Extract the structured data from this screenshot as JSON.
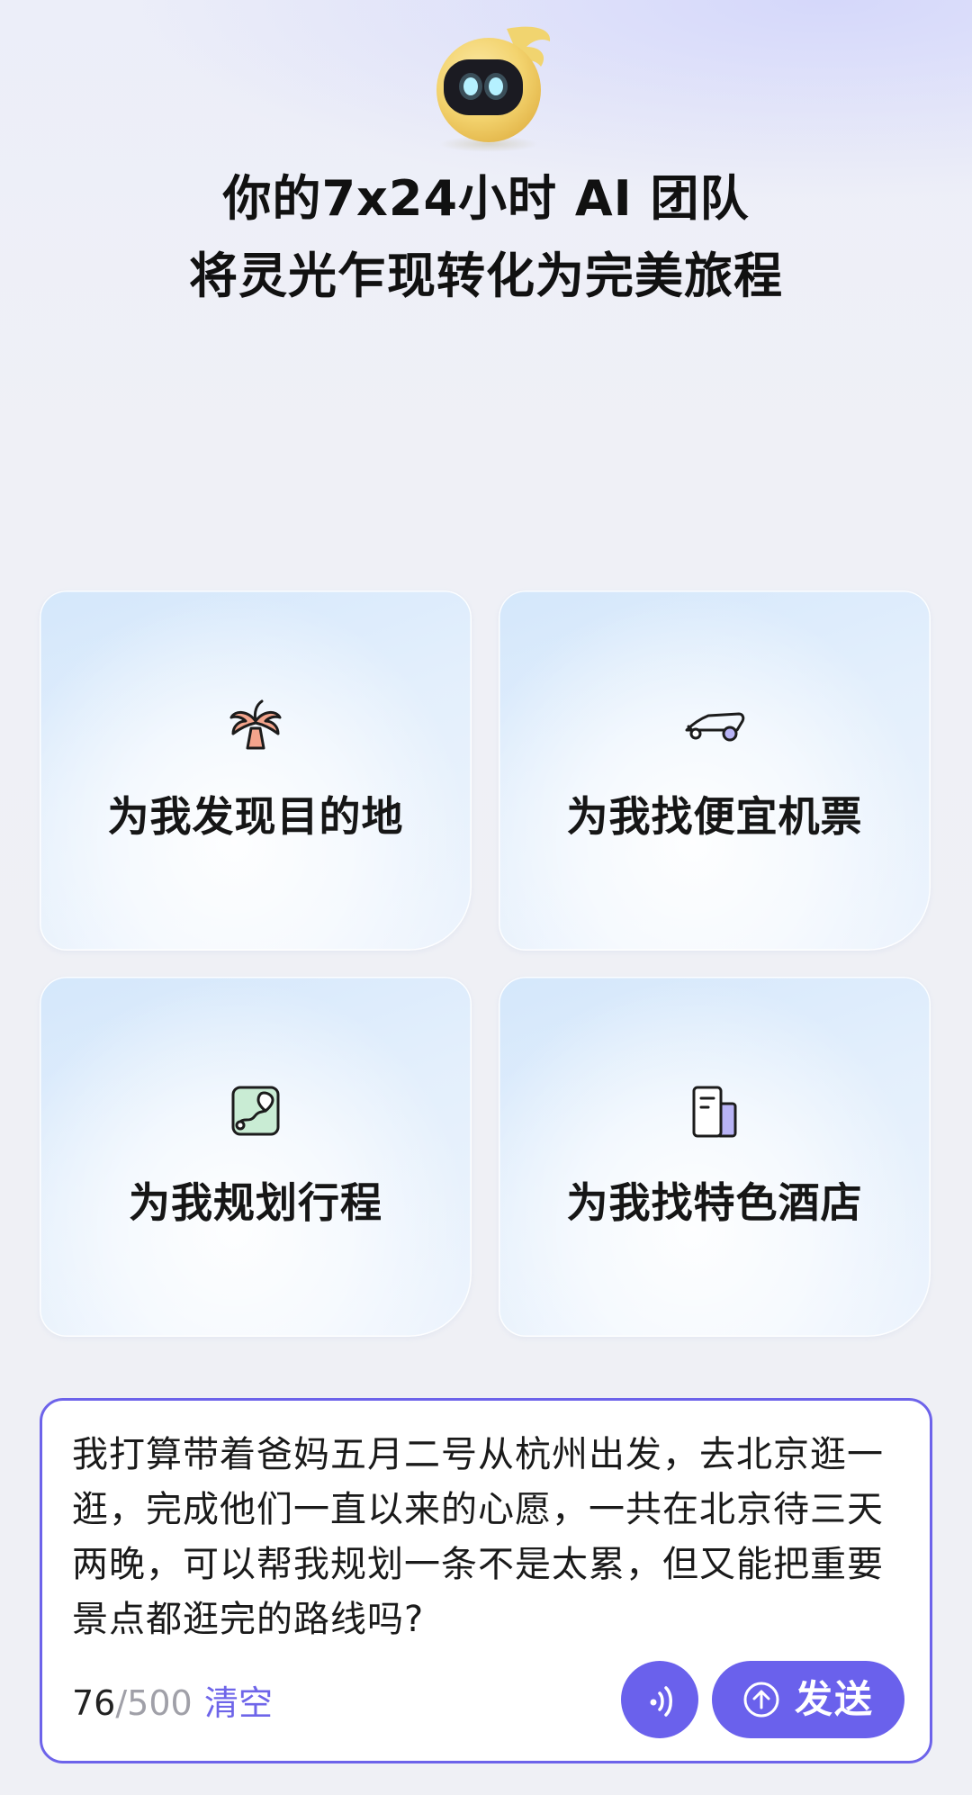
{
  "hero": {
    "line1": "你的7x24小时 AI 团队",
    "line2": "将灵光乍现转化为完美旅程"
  },
  "cards": [
    {
      "label": "为我发现目的地",
      "icon": "palm-tree-icon"
    },
    {
      "label": "为我找便宜机票",
      "icon": "plane-icon"
    },
    {
      "label": "为我规划行程",
      "icon": "map-route-icon"
    },
    {
      "label": "为我找特色酒店",
      "icon": "hotel-building-icon"
    }
  ],
  "input": {
    "text": "我打算带着爸妈五月二号从杭州出发，去北京逛一逛，完成他们一直以来的心愿，一共在北京待三天两晚，可以帮我规划一条不是太累，但又能把重要景点都逛完的路线吗?",
    "count": "76",
    "separator": "/",
    "max": "500",
    "clear_label": "清空",
    "send_label": "发送"
  },
  "colors": {
    "accent": "#6a61ec",
    "border": "#6d63ea",
    "background": "#eff0f5"
  }
}
